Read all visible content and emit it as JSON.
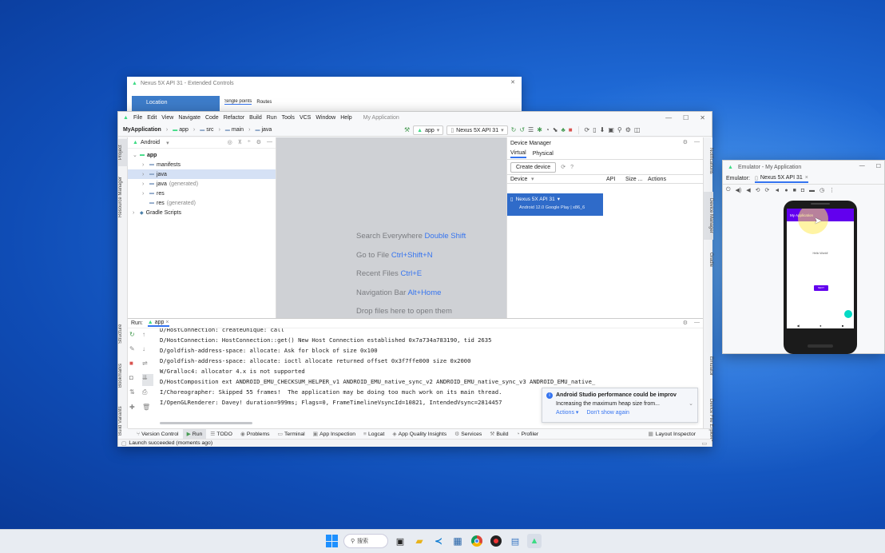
{
  "extended": {
    "title": "Nexus 5X API 31 - Extended Controls",
    "sidebar_item": "Location",
    "tabs": [
      "Single points",
      "Routes"
    ]
  },
  "studio": {
    "menu": [
      "File",
      "Edit",
      "View",
      "Navigate",
      "Code",
      "Refactor",
      "Build",
      "Run",
      "Tools",
      "VCS",
      "Window",
      "Help"
    ],
    "app_title": "My Application",
    "breadcrumb": [
      "MyApplication",
      "app",
      "src",
      "main",
      "java"
    ],
    "run_config": "app",
    "device": "Nexus 5X API 31",
    "project_left_tab": "Project",
    "left_tabs": [
      "Resource Manager",
      "Structure",
      "Bookmarks",
      "Build Variants"
    ],
    "right_tabs": [
      "Notifications",
      "Device Manager",
      "Gradle",
      "Emulator",
      "Device File Explorer"
    ],
    "project_view": "Android",
    "tree": [
      {
        "label": "app",
        "extra": "",
        "indent": 0,
        "arrow": "⌄",
        "icon": "folder",
        "bold": true
      },
      {
        "label": "manifests",
        "extra": "",
        "indent": 1,
        "arrow": "›",
        "icon": "folder",
        "bold": false
      },
      {
        "label": "java",
        "extra": "",
        "indent": 1,
        "arrow": "›",
        "icon": "folder",
        "bold": false,
        "selected": true
      },
      {
        "label": "java",
        "extra": "(generated)",
        "indent": 1,
        "arrow": "›",
        "icon": "folder",
        "bold": false
      },
      {
        "label": "res",
        "extra": "",
        "indent": 1,
        "arrow": "›",
        "icon": "folder",
        "bold": false
      },
      {
        "label": "res",
        "extra": "(generated)",
        "indent": 1,
        "arrow": "",
        "icon": "folder",
        "bold": false
      },
      {
        "label": "Gradle Scripts",
        "extra": "",
        "indent": 0,
        "arrow": "›",
        "icon": "gradle",
        "bold": false
      }
    ],
    "hints": [
      {
        "text": "Search Everywhere",
        "key": "Double Shift"
      },
      {
        "text": "Go to File",
        "key": "Ctrl+Shift+N"
      },
      {
        "text": "Recent Files",
        "key": "Ctrl+E"
      },
      {
        "text": "Navigation Bar",
        "key": "Alt+Home"
      },
      {
        "text": "Drop files here to open them",
        "key": ""
      }
    ],
    "device_manager": {
      "title": "Device Manager",
      "tabs": [
        "Virtual",
        "Physical"
      ],
      "create_label": "Create device",
      "columns": [
        "Device",
        "API",
        "Size ...",
        "Actions"
      ],
      "device_name": "Nexus 5X API 31",
      "device_detail": "Android 12.0 Google Play | x86_6"
    },
    "run": {
      "label": "Run:",
      "config": "app",
      "logs": [
        "D/HostConnection: createUnique: call",
        "D/HostConnection: HostConnection::get() New Host Connection established 0x7a734a783190, tid 2635",
        "D/goldfish-address-space: allocate: Ask for block of size 0x100",
        "D/goldfish-address-space: allocate: ioctl allocate returned offset 0x3f7ffe000 size 0x2000",
        "W/Gralloc4: allocator 4.x is not supported",
        "D/HostComposition ext ANDROID_EMU_CHECKSUM_HELPER_v1 ANDROID_EMU_native_sync_v2 ANDROID_EMU_native_sync_v3 ANDROID_EMU_native_",
        "I/Choreographer: Skipped 55 frames!  The application may be doing too much work on its main thread.",
        "I/OpenGLRenderer: Davey! duration=999ms; Flags=0, FrameTimelineVsyncId=10821, IntendedVsync=2814457"
      ]
    },
    "notification": {
      "title": "Android Studio performance could be improv",
      "body": "Increasing the maximum heap size from...",
      "actions": "Actions",
      "dismiss": "Don't show again"
    },
    "bottom_tabs": [
      "Version Control",
      "Run",
      "TODO",
      "Problems",
      "Terminal",
      "App Inspection",
      "Logcat",
      "App Quality Insights",
      "Services",
      "Build",
      "Profiler"
    ],
    "layout_inspector": "Layout Inspector",
    "status": "Launch succeeded (moments ago)"
  },
  "emulator": {
    "title": "Emulator - My Application",
    "label": "Emulator:",
    "tab": "Nexus 5X API 31",
    "app_bar": "My Application",
    "body_text": "Hello World!",
    "button": "NEXT"
  },
  "taskbar": {
    "search": "搜索"
  },
  "colors": {
    "accent": "#3574f0",
    "desktop": "#1f6ad6",
    "app_bar": "#6200ee",
    "fab": "#03dac5"
  }
}
